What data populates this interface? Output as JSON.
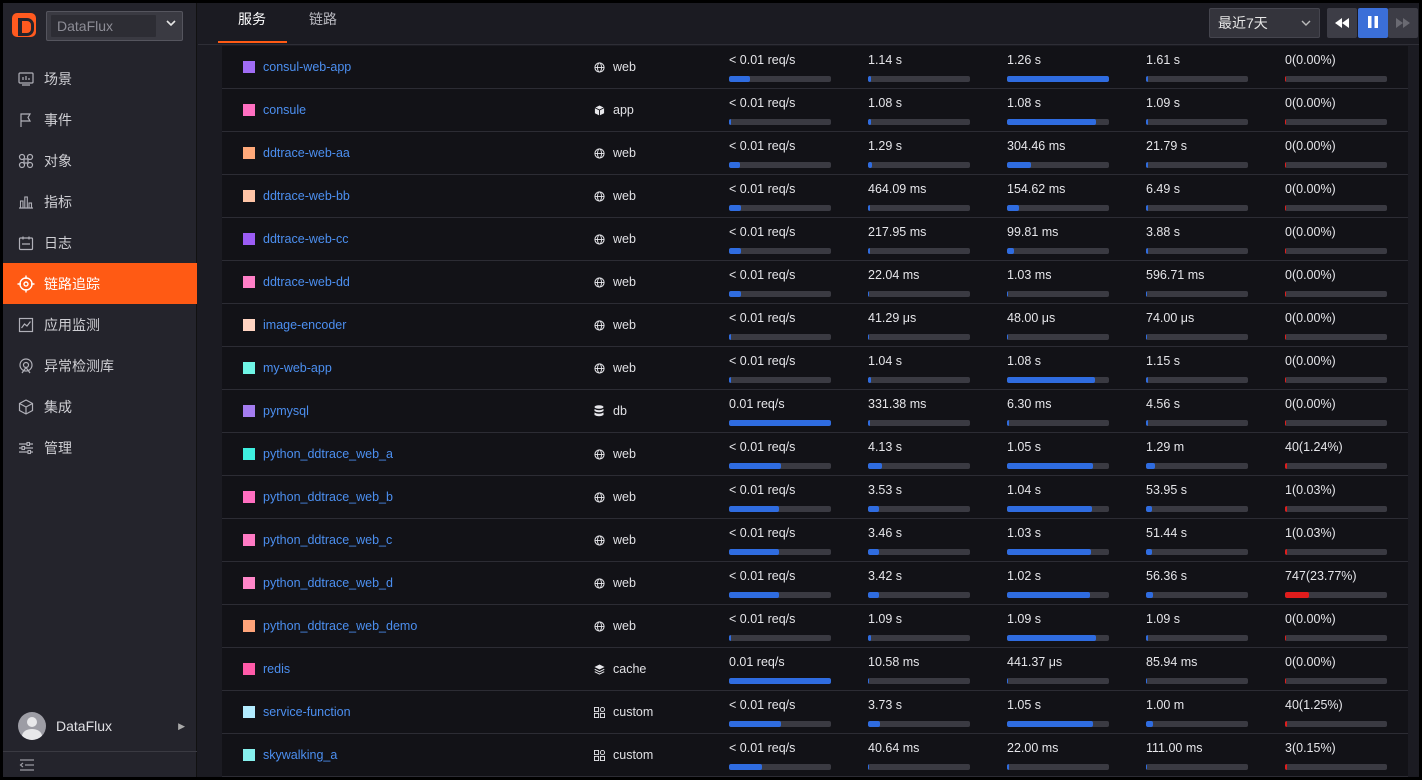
{
  "brand": {
    "accent": "#ff5a14",
    "link": "#4c8ff0",
    "bar": "#2f6ce0",
    "error": "#e01c1c"
  },
  "sidebar": {
    "workspace": "DataFlux",
    "items": [
      {
        "label": "场景",
        "icon": "monitor-icon"
      },
      {
        "label": "事件",
        "icon": "flag-icon"
      },
      {
        "label": "对象",
        "icon": "command-icon"
      },
      {
        "label": "指标",
        "icon": "bar-chart-icon"
      },
      {
        "label": "日志",
        "icon": "calendar-icon"
      },
      {
        "label": "链路追踪",
        "icon": "target-icon",
        "active": true
      },
      {
        "label": "应用监测",
        "icon": "dashboard-icon"
      },
      {
        "label": "异常检测库",
        "icon": "radar-icon"
      },
      {
        "label": "集成",
        "icon": "cube-icon"
      },
      {
        "label": "管理",
        "icon": "sliders-icon"
      }
    ],
    "user": "DataFlux"
  },
  "header": {
    "tabs": [
      {
        "label": "服务",
        "active": true
      },
      {
        "label": "链路",
        "active": false
      }
    ],
    "time_range": "最近7天"
  },
  "services": [
    {
      "name": "consul-web-app",
      "color": "#a06cf5",
      "type": "web",
      "req": "< 0.01 req/s",
      "req_pct": 0.21,
      "m1": "1.14 s",
      "m1_pct": 0.03,
      "m2": "1.26 s",
      "m2_pct": 1.0,
      "m3": "1.61 s",
      "m3_pct": 0.01,
      "err": "0(0.00%)",
      "err_pct": 0
    },
    {
      "name": "consule",
      "color": "#ff6fc1",
      "type": "app",
      "req": "< 0.01 req/s",
      "req_pct": 0.01,
      "m1": "1.08 s",
      "m1_pct": 0.03,
      "m2": "1.08 s",
      "m2_pct": 0.87,
      "m3": "1.09 s",
      "m3_pct": 0.01,
      "err": "0(0.00%)",
      "err_pct": 0
    },
    {
      "name": "ddtrace-web-aa",
      "color": "#ffa97a",
      "type": "web",
      "req": "< 0.01 req/s",
      "req_pct": 0.11,
      "m1": "1.29 s",
      "m1_pct": 0.04,
      "m2": "304.46 ms",
      "m2_pct": 0.24,
      "m3": "21.79 s",
      "m3_pct": 0.02,
      "err": "0(0.00%)",
      "err_pct": 0
    },
    {
      "name": "ddtrace-web-bb",
      "color": "#ffc4a6",
      "type": "web",
      "req": "< 0.01 req/s",
      "req_pct": 0.12,
      "m1": "464.09 ms",
      "m1_pct": 0.01,
      "m2": "154.62 ms",
      "m2_pct": 0.12,
      "m3": "6.49 s",
      "m3_pct": 0.01,
      "err": "0(0.00%)",
      "err_pct": 0
    },
    {
      "name": "ddtrace-web-cc",
      "color": "#9c5cf5",
      "type": "web",
      "req": "< 0.01 req/s",
      "req_pct": 0.12,
      "m1": "217.95 ms",
      "m1_pct": 0.01,
      "m2": "99.81 ms",
      "m2_pct": 0.07,
      "m3": "3.88 s",
      "m3_pct": 0.01,
      "err": "0(0.00%)",
      "err_pct": 0
    },
    {
      "name": "ddtrace-web-dd",
      "color": "#ff7fc7",
      "type": "web",
      "req": "< 0.01 req/s",
      "req_pct": 0.12,
      "m1": "22.04 ms",
      "m1_pct": 0.0,
      "m2": "1.03 ms",
      "m2_pct": 0.0,
      "m3": "596.71 ms",
      "m3_pct": 0.0,
      "err": "0(0.00%)",
      "err_pct": 0
    },
    {
      "name": "image-encoder",
      "color": "#ffd4c2",
      "type": "web",
      "req": "< 0.01 req/s",
      "req_pct": 0.01,
      "m1": "41.29 μs",
      "m1_pct": 0.0,
      "m2": "48.00 μs",
      "m2_pct": 0.0,
      "m3": "74.00 μs",
      "m3_pct": 0.0,
      "err": "0(0.00%)",
      "err_pct": 0
    },
    {
      "name": "my-web-app",
      "color": "#6ff5e6",
      "type": "web",
      "req": "< 0.01 req/s",
      "req_pct": 0.01,
      "m1": "1.04 s",
      "m1_pct": 0.03,
      "m2": "1.08 s",
      "m2_pct": 0.86,
      "m3": "1.15 s",
      "m3_pct": 0.01,
      "err": "0(0.00%)",
      "err_pct": 0
    },
    {
      "name": "pymysql",
      "color": "#a47cf0",
      "type": "db",
      "req": "0.01 req/s",
      "req_pct": 1.0,
      "m1": "331.38 ms",
      "m1_pct": 0.01,
      "m2": "6.30 ms",
      "m2_pct": 0.01,
      "m3": "4.56 s",
      "m3_pct": 0.01,
      "err": "0(0.00%)",
      "err_pct": 0
    },
    {
      "name": "python_ddtrace_web_a",
      "color": "#3ef0e0",
      "type": "web",
      "req": "< 0.01 req/s",
      "req_pct": 0.51,
      "m1": "4.13 s",
      "m1_pct": 0.14,
      "m2": "1.05 s",
      "m2_pct": 0.84,
      "m3": "1.29 m",
      "m3_pct": 0.09,
      "err": "40(1.24%)",
      "err_pct": 0.02
    },
    {
      "name": "python_ddtrace_web_b",
      "color": "#ff6ec0",
      "type": "web",
      "req": "< 0.01 req/s",
      "req_pct": 0.49,
      "m1": "3.53 s",
      "m1_pct": 0.11,
      "m2": "1.04 s",
      "m2_pct": 0.83,
      "m3": "53.95 s",
      "m3_pct": 0.06,
      "err": "1(0.03%)",
      "err_pct": 0.003
    },
    {
      "name": "python_ddtrace_web_c",
      "color": "#ff7ac4",
      "type": "web",
      "req": "< 0.01 req/s",
      "req_pct": 0.49,
      "m1": "3.46 s",
      "m1_pct": 0.11,
      "m2": "1.03 s",
      "m2_pct": 0.82,
      "m3": "51.44 s",
      "m3_pct": 0.06,
      "err": "1(0.03%)",
      "err_pct": 0.003
    },
    {
      "name": "python_ddtrace_web_d",
      "color": "#ff86c9",
      "type": "web",
      "req": "< 0.01 req/s",
      "req_pct": 0.49,
      "m1": "3.42 s",
      "m1_pct": 0.11,
      "m2": "1.02 s",
      "m2_pct": 0.81,
      "m3": "56.36 s",
      "m3_pct": 0.07,
      "err": "747(23.77%)",
      "err_pct": 0.24
    },
    {
      "name": "python_ddtrace_web_demo",
      "color": "#ffa47a",
      "type": "web",
      "req": "< 0.01 req/s",
      "req_pct": 0.01,
      "m1": "1.09 s",
      "m1_pct": 0.03,
      "m2": "1.09 s",
      "m2_pct": 0.87,
      "m3": "1.09 s",
      "m3_pct": 0.01,
      "err": "0(0.00%)",
      "err_pct": 0
    },
    {
      "name": "redis",
      "color": "#ff5aa8",
      "type": "cache",
      "req": "0.01 req/s",
      "req_pct": 1.0,
      "m1": "10.58 ms",
      "m1_pct": 0.0,
      "m2": "441.37 μs",
      "m2_pct": 0.0,
      "m3": "85.94 ms",
      "m3_pct": 0.0,
      "err": "0(0.00%)",
      "err_pct": 0
    },
    {
      "name": "service-function",
      "color": "#b3ecff",
      "type": "custom",
      "req": "< 0.01 req/s",
      "req_pct": 0.51,
      "m1": "3.73 s",
      "m1_pct": 0.12,
      "m2": "1.05 s",
      "m2_pct": 0.84,
      "m3": "1.00 m",
      "m3_pct": 0.07,
      "err": "40(1.25%)",
      "err_pct": 0.02
    },
    {
      "name": "skywalking_a",
      "color": "#86f0ee",
      "type": "custom",
      "req": "< 0.01 req/s",
      "req_pct": 0.32,
      "m1": "40.64 ms",
      "m1_pct": 0.0,
      "m2": "22.00 ms",
      "m2_pct": 0.02,
      "m3": "111.00 ms",
      "m3_pct": 0.0,
      "err": "3(0.15%)",
      "err_pct": 0.005
    }
  ]
}
